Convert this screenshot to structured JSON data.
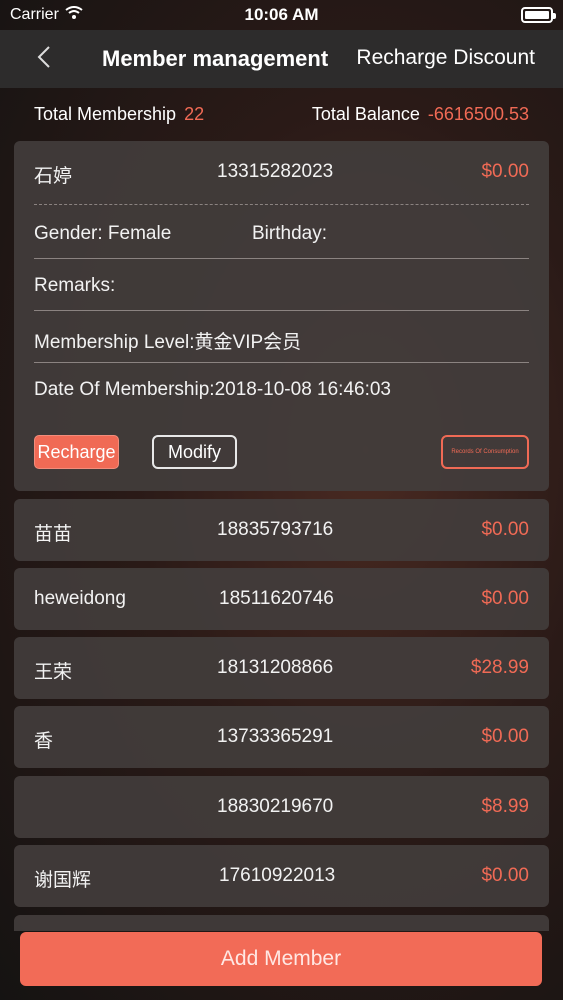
{
  "status_bar": {
    "carrier": "Carrier",
    "time": "10:06 AM"
  },
  "nav": {
    "title": "Member management",
    "action": "Recharge Discount"
  },
  "summary": {
    "total_membership_label": "Total Membership",
    "total_membership_value": "22",
    "total_balance_label": "Total Balance",
    "total_balance_value": "-6616500.53"
  },
  "expanded_member": {
    "name": "石婷",
    "phone": "13315282023",
    "balance": "$0.00",
    "gender": "Gender: Female",
    "birthday": "Birthday:",
    "remarks": "Remarks:",
    "level": "Membership Level:黄金VIP会员",
    "date": "Date Of Membership:2018-10-08 16:46:03",
    "recharge_label": "Recharge",
    "modify_label": "Modify",
    "records_label": "Records Of Consumption"
  },
  "members": [
    {
      "name": "苗苗",
      "phone": "18835793716",
      "balance": "$0.00"
    },
    {
      "name": "heweidong",
      "phone": "18511620746",
      "balance": "$0.00"
    },
    {
      "name": "王荣",
      "phone": "18131208866",
      "balance": "$28.99"
    },
    {
      "name": "香",
      "phone": "13733365291",
      "balance": "$0.00"
    },
    {
      "name": "",
      "phone": "18830219670",
      "balance": "$8.99"
    },
    {
      "name": "谢国辉",
      "phone": "17610922013",
      "balance": "$0.00"
    }
  ],
  "footer": {
    "add_member_label": "Add Member"
  },
  "colors": {
    "accent": "#f06a55",
    "nav_background": "#2d2c2c",
    "card_background": "#423d3c"
  }
}
